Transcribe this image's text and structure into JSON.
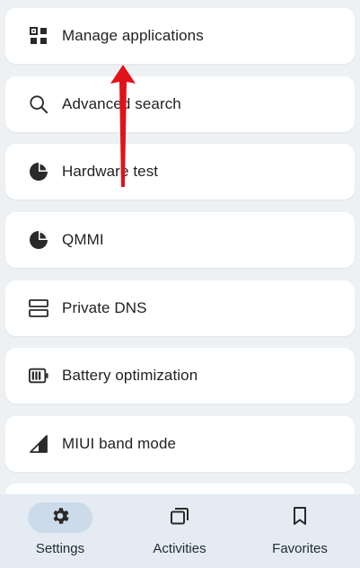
{
  "menu": {
    "items": [
      {
        "label": "Manage applications",
        "icon": "grid-apps-icon"
      },
      {
        "label": "Advanced search",
        "icon": "search-icon"
      },
      {
        "label": "Hardware test",
        "icon": "pie-chart-icon"
      },
      {
        "label": "QMMI",
        "icon": "pie-chart-icon"
      },
      {
        "label": "Private DNS",
        "icon": "server-icon"
      },
      {
        "label": "Battery optimization",
        "icon": "battery-icon"
      },
      {
        "label": "MIUI band mode",
        "icon": "signal-icon"
      }
    ]
  },
  "bottom_nav": {
    "items": [
      {
        "label": "Settings",
        "icon": "gear-icon",
        "active": true
      },
      {
        "label": "Activities",
        "icon": "activities-icon",
        "active": false
      },
      {
        "label": "Favorites",
        "icon": "bookmark-icon",
        "active": false
      }
    ]
  },
  "colors": {
    "annotation_arrow": "#e0131b",
    "nav_background": "#e4ebf2",
    "nav_active_pill": "#ccdbea"
  }
}
